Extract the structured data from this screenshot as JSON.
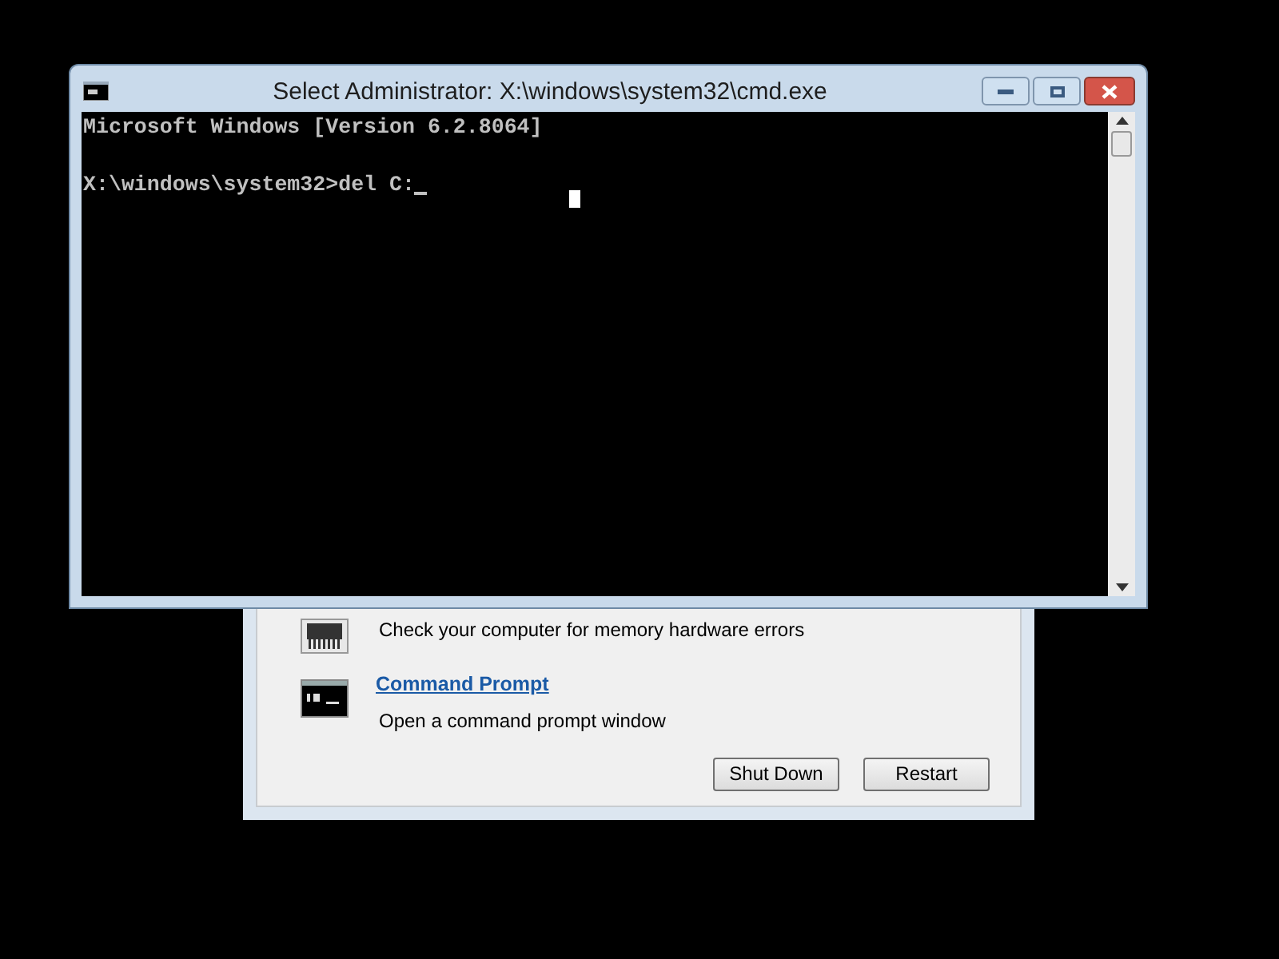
{
  "console_window": {
    "title": "Select Administrator: X:\\windows\\system32\\cmd.exe",
    "paragraphs": [
      [
        "Microsoft Windows [Version 6.2.8064]"
      ],
      [
        "X:\\windows\\system32>del C:"
      ]
    ]
  },
  "recovery_dialog": {
    "options": [
      {
        "kind": "memory",
        "description": "Check your computer for memory hardware errors"
      },
      {
        "kind": "prompt",
        "title": "Command Prompt",
        "description": "Open a command prompt window"
      }
    ],
    "buttons": [
      "Shut Down",
      "Restart"
    ]
  }
}
